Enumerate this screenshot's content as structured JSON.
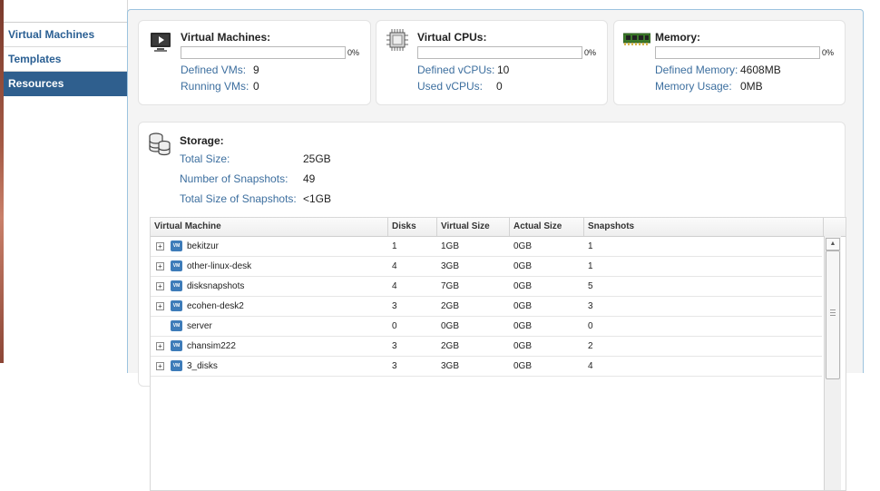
{
  "sidebar": {
    "items": [
      {
        "label": "Virtual Machines",
        "active": false
      },
      {
        "label": "Templates",
        "active": false
      },
      {
        "label": "Resources",
        "active": true
      }
    ]
  },
  "vms_card": {
    "title": "Virtual Machines:",
    "percent": "0%",
    "usage_fraction": 0,
    "defined_label": "Defined VMs:",
    "defined_value": "9",
    "running_label": "Running VMs:",
    "running_value": "0",
    "icon": "monitor-play-icon"
  },
  "cpus_card": {
    "title": "Virtual CPUs:",
    "percent": "0%",
    "usage_fraction": 0,
    "defined_label": "Defined vCPUs:",
    "defined_value": "10",
    "used_label": "Used vCPUs:",
    "used_value": "0",
    "icon": "cpu-chip-icon"
  },
  "memory_card": {
    "title": "Memory:",
    "percent": "0%",
    "usage_fraction": 0,
    "defined_label": "Defined Memory:",
    "defined_value": "4608MB",
    "usage_label": "Memory Usage:",
    "usage_value": "0MB",
    "icon": "memory-module-icon"
  },
  "storage": {
    "title": "Storage:",
    "icon": "database-stack-icon",
    "total_size_label": "Total Size:",
    "total_size_value": "25GB",
    "snapshots_label": "Number of Snapshots:",
    "snapshots_value": "49",
    "snapshot_size_label": "Total Size of Snapshots:",
    "snapshot_size_value": "<1GB",
    "table": {
      "columns": [
        "Virtual Machine",
        "Disks",
        "Virtual Size",
        "Actual Size",
        "Snapshots"
      ],
      "rows": [
        {
          "name": "bekitzur",
          "disks": "1",
          "virtual_size": "1GB",
          "actual_size": "0GB",
          "snapshots": "1",
          "expandable": true
        },
        {
          "name": "other-linux-desk",
          "disks": "4",
          "virtual_size": "3GB",
          "actual_size": "0GB",
          "snapshots": "1",
          "expandable": true
        },
        {
          "name": "disksnapshots",
          "disks": "4",
          "virtual_size": "7GB",
          "actual_size": "0GB",
          "snapshots": "5",
          "expandable": true
        },
        {
          "name": "ecohen-desk2",
          "disks": "3",
          "virtual_size": "2GB",
          "actual_size": "0GB",
          "snapshots": "3",
          "expandable": true
        },
        {
          "name": "server",
          "disks": "0",
          "virtual_size": "0GB",
          "actual_size": "0GB",
          "snapshots": "0",
          "expandable": false
        },
        {
          "name": "chansim222",
          "disks": "3",
          "virtual_size": "2GB",
          "actual_size": "0GB",
          "snapshots": "2",
          "expandable": true
        },
        {
          "name": "3_disks",
          "disks": "3",
          "virtual_size": "3GB",
          "actual_size": "0GB",
          "snapshots": "4",
          "expandable": true
        }
      ]
    }
  },
  "colors": {
    "accent": "#2f5f8e",
    "label_blue": "#3d6f9f",
    "panel_border": "#9cc3df"
  }
}
